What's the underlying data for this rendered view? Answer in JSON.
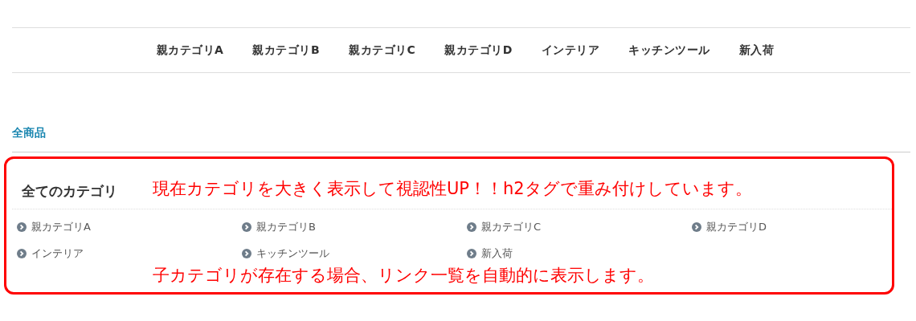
{
  "nav": {
    "items": [
      "親カテゴリA",
      "親カテゴリB",
      "親カテゴリC",
      "親カテゴリD",
      "インテリア",
      "キッチンツール",
      "新入荷"
    ]
  },
  "breadcrumb": "全商品",
  "category_panel": {
    "title": "全てのカテゴリ",
    "annotation_top": "現在カテゴリを大きく表示して視認性UP！！h2タグで重み付けしています。",
    "links": [
      "親カテゴリA",
      "親カテゴリB",
      "親カテゴリC",
      "親カテゴリD",
      "インテリア",
      "キッチンツール",
      "新入荷"
    ],
    "annotation_bottom": "子カテゴリが存在する場合、リンク一覧を自動的に表示します。"
  }
}
